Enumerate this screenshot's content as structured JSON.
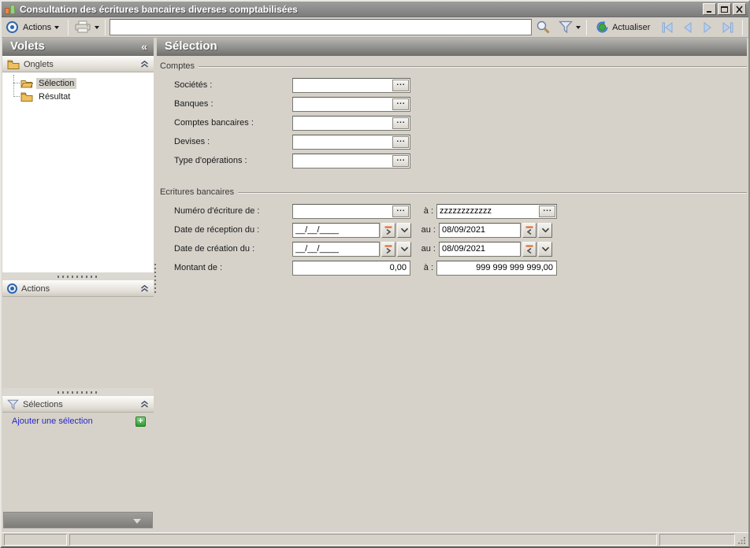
{
  "window": {
    "title": "Consultation des écritures bancaires diverses comptabilisées"
  },
  "toolbar": {
    "actions_label": "Actions",
    "search_value": "",
    "actualiser_label": "Actualiser"
  },
  "sidebar": {
    "title": "Volets",
    "collapse_glyph": "«",
    "onglets_label": "Onglets",
    "tree": [
      {
        "label": "Sélection"
      },
      {
        "label": "Résultat"
      }
    ],
    "actions_label": "Actions",
    "selections_label": "Sélections",
    "add_selection_label": "Ajouter une sélection",
    "add_selection_plus": "+"
  },
  "main": {
    "title": "Sélection",
    "comptes": {
      "label": "Comptes",
      "fields": [
        {
          "label": "Sociétés :",
          "value": ""
        },
        {
          "label": "Banques :",
          "value": ""
        },
        {
          "label": "Comptes bancaires :",
          "value": ""
        },
        {
          "label": "Devises :",
          "value": ""
        },
        {
          "label": "Type d'opérations :",
          "value": ""
        }
      ]
    },
    "ecritures": {
      "label": "Ecritures bancaires",
      "numero": {
        "label": "Numéro d'écriture de :",
        "value": "",
        "to_label": "à :",
        "to_value": "zzzzzzzzzzzz"
      },
      "date_reception": {
        "label": "Date de réception du :",
        "value": "__/__/____",
        "to_label": "au :",
        "to_value": "08/09/2021"
      },
      "date_creation": {
        "label": "Date de création du :",
        "value": "__/__/____",
        "to_label": "au :",
        "to_value": "08/09/2021"
      },
      "montant": {
        "label": "Montant de :",
        "value": "0,00",
        "to_label": "à :",
        "to_value": "999 999 999 999,00"
      }
    }
  },
  "ui": {
    "ellipsis": "...",
    "colors": {
      "accent_blue": "#2e64ad",
      "folder_gold": "#efc05f",
      "orange_mark": "#e2622b",
      "link_blue": "#2828c8",
      "plus_green": "#2f9b2f"
    }
  }
}
